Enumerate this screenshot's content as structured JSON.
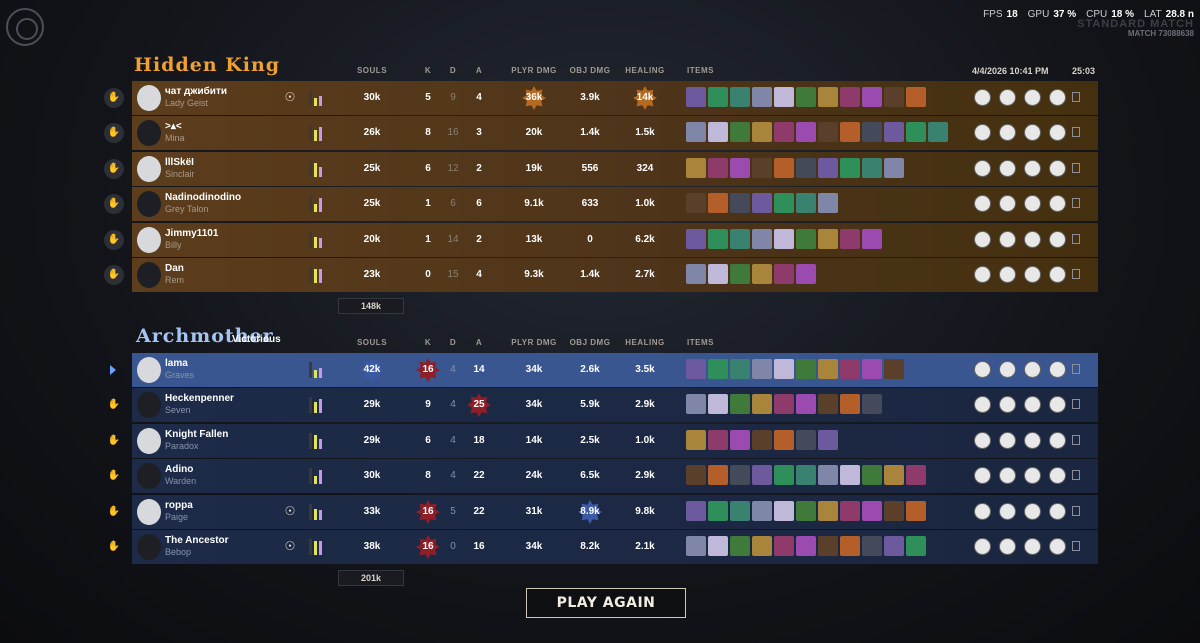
{
  "perf": {
    "fps_label": "FPS",
    "fps": "18",
    "gpu_label": "GPU",
    "gpu": "37 %",
    "cpu_label": "CPU",
    "cpu": "18 %",
    "lat_label": "LAT",
    "lat": "28.8 n"
  },
  "mode": "STANDARD MATCH",
  "match_id": "MATCH 73088638",
  "date": "4/4/2026 10:41 PM",
  "duration": "25:03",
  "headers": {
    "souls": "SOULS",
    "k": "K",
    "d": "D",
    "a": "A",
    "plyr": "PLYR DMG",
    "obj": "OBJ DMG",
    "heal": "HEALING",
    "items": "ITEMS"
  },
  "team1": {
    "name": "Hidden King",
    "total": "148k",
    "players": [
      {
        "name": "чат джибити",
        "hero": "Lady Geist",
        "souls": "30k",
        "k": "5",
        "d": "9",
        "a": "4",
        "plyr": "36k",
        "obj": "3.9k",
        "heal": "14k",
        "star_plyr": true,
        "star_heal": true,
        "badge": true,
        "items": 11
      },
      {
        "name": ">▴<",
        "hero": "Mina",
        "souls": "26k",
        "k": "8",
        "d": "16",
        "a": "3",
        "plyr": "20k",
        "obj": "1.4k",
        "heal": "1.5k",
        "items": 12
      },
      {
        "name": "lllSkëI",
        "hero": "Sinclair",
        "souls": "25k",
        "k": "6",
        "d": "12",
        "a": "2",
        "plyr": "19k",
        "obj": "556",
        "heal": "324",
        "items": 10
      },
      {
        "name": "Nadinodinodino",
        "hero": "Grey Talon",
        "souls": "25k",
        "k": "1",
        "d": "6",
        "a": "6",
        "plyr": "9.1k",
        "obj": "633",
        "heal": "1.0k",
        "items": 7
      },
      {
        "name": "Jimmy1101",
        "hero": "Billy",
        "souls": "20k",
        "k": "1",
        "d": "14",
        "a": "2",
        "plyr": "13k",
        "obj": "0",
        "heal": "6.2k",
        "items": 9
      },
      {
        "name": "Dan",
        "hero": "Rem",
        "souls": "23k",
        "k": "0",
        "d": "15",
        "a": "4",
        "plyr": "9.3k",
        "obj": "1.4k",
        "heal": "2.7k",
        "items": 6
      }
    ]
  },
  "team2": {
    "name": "Archmother",
    "status": "Victorious",
    "total": "201k",
    "players": [
      {
        "name": "lama",
        "hero": "Graves",
        "souls": "42k",
        "k": "16",
        "d": "4",
        "a": "14",
        "plyr": "34k",
        "obj": "2.6k",
        "heal": "3.5k",
        "star_souls": true,
        "star_k": true,
        "items": 10
      },
      {
        "name": "Heckenpenner",
        "hero": "Seven",
        "souls": "29k",
        "k": "9",
        "d": "4",
        "a": "25",
        "plyr": "34k",
        "obj": "5.9k",
        "heal": "2.9k",
        "star_a": true,
        "items": 9
      },
      {
        "name": "Knight Fallen",
        "hero": "Paradox",
        "souls": "29k",
        "k": "6",
        "d": "4",
        "a": "18",
        "plyr": "14k",
        "obj": "2.5k",
        "heal": "1.0k",
        "items": 7
      },
      {
        "name": "Adino",
        "hero": "Warden",
        "souls": "30k",
        "k": "8",
        "d": "4",
        "a": "22",
        "plyr": "24k",
        "obj": "6.5k",
        "heal": "2.9k",
        "items": 11
      },
      {
        "name": "roppa",
        "hero": "Paige",
        "souls": "33k",
        "k": "16",
        "d": "5",
        "a": "22",
        "plyr": "31k",
        "obj": "8.9k",
        "heal": "9.8k",
        "star_k": true,
        "star_obj": true,
        "badge": true,
        "items": 11
      },
      {
        "name": "The Ancestor",
        "hero": "Bebop",
        "souls": "38k",
        "k": "16",
        "d": "0",
        "a": "16",
        "plyr": "34k",
        "obj": "8.2k",
        "heal": "2.1k",
        "star_k": true,
        "badge": true,
        "items": 11
      }
    ]
  },
  "play_again": "PLAY AGAIN",
  "colors": {
    "amber": "#5c3d1c",
    "blue": "#1d2b48",
    "selected": "#3a5690",
    "orange_title": "#f0a030",
    "blue_title": "#a6c4f2"
  }
}
